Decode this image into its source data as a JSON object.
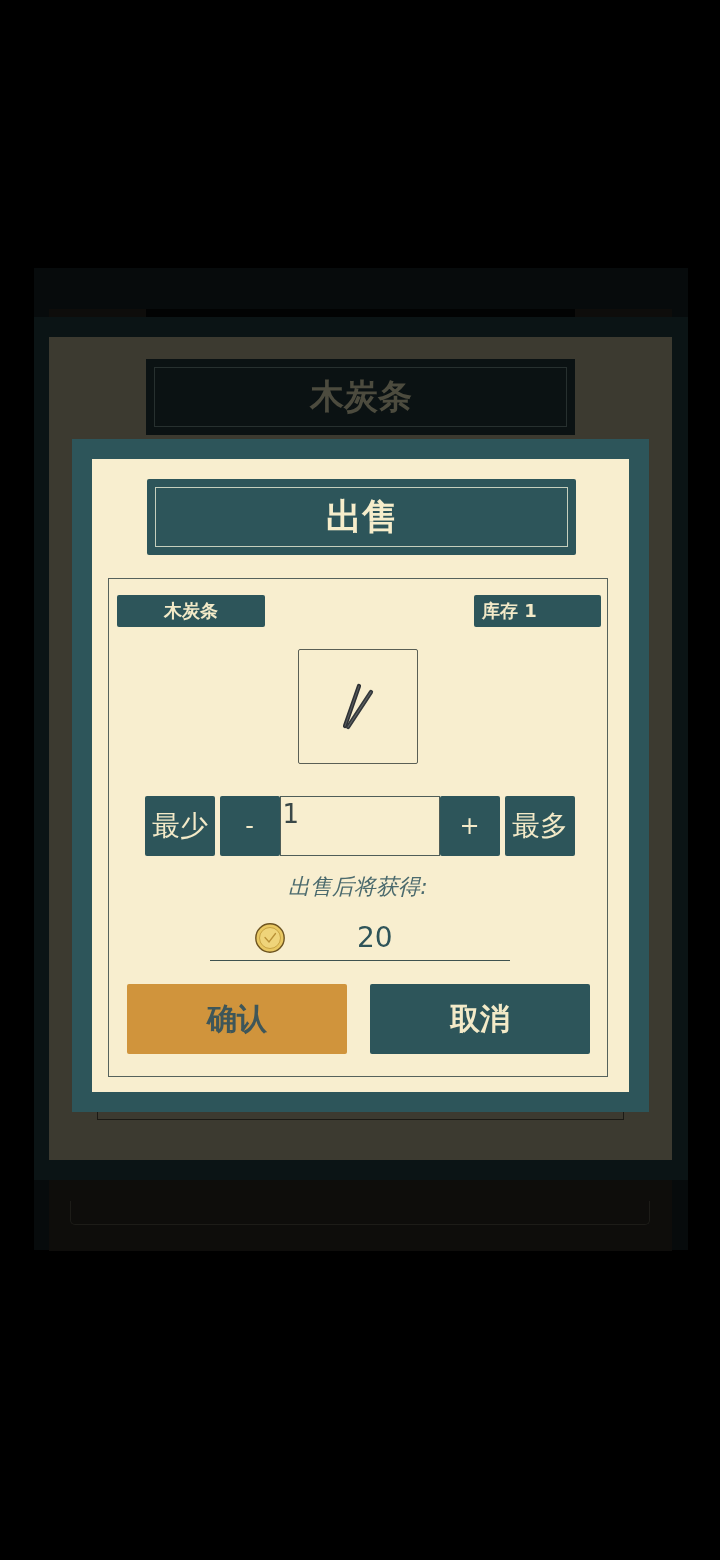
{
  "background_dialog": {
    "title": "木炭条"
  },
  "sell_dialog": {
    "title": "出售",
    "item": {
      "name": "木炭条",
      "stock": "库存 1"
    },
    "quantity": {
      "min_button": "最少",
      "decrement_button": "-",
      "value": "1",
      "increment_button": "+",
      "max_button": "最多"
    },
    "reward": {
      "label": "出售后将获得:",
      "amount": "20"
    },
    "buttons": [
      {
        "label": "确认",
        "kind": "confirm"
      },
      {
        "label": "取消",
        "kind": "cancel"
      }
    ]
  }
}
